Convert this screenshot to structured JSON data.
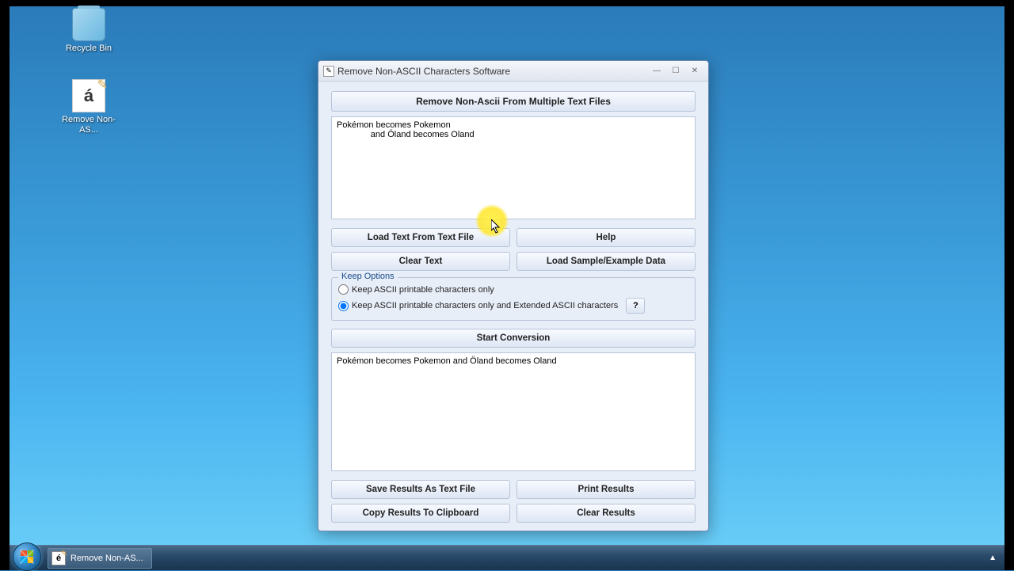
{
  "desktop": {
    "recycle_bin": "Recycle Bin",
    "app_shortcut": "Remove Non-AS..."
  },
  "window": {
    "title": "Remove Non-ASCII Characters Software",
    "banner": "Remove Non-Ascii From Multiple Text Files",
    "input_text": "Pokémon becomes Pokemon\n              and Öland becomes Oland",
    "buttons": {
      "load_file": "Load Text From Text File",
      "help": "Help",
      "clear_text": "Clear Text",
      "load_sample": "Load Sample/Example Data",
      "start": "Start Conversion",
      "save_results": "Save Results As Text File",
      "print_results": "Print Results",
      "copy_results": "Copy Results To Clipboard",
      "clear_results": "Clear Results"
    },
    "options": {
      "legend": "Keep Options",
      "opt1": "Keep ASCII printable characters only",
      "opt2": "Keep ASCII printable characters only and Extended ASCII characters",
      "help_q": "?"
    },
    "output_text": "Pokémon becomes Pokemon and Öland becomes Oland"
  },
  "taskbar": {
    "app": "Remove Non-AS..."
  }
}
